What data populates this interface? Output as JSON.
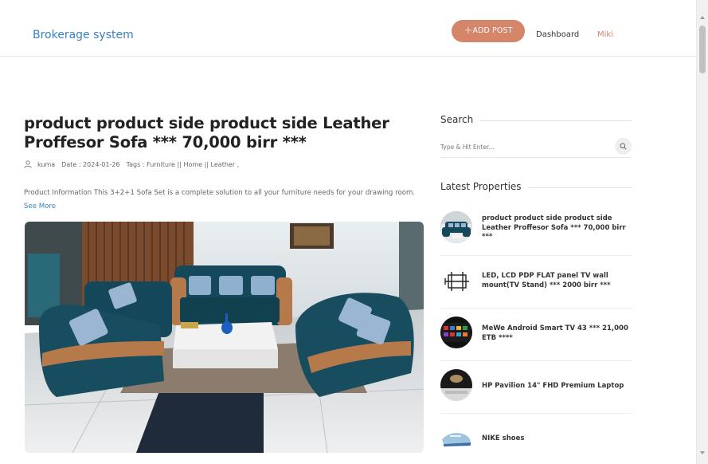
{
  "header": {
    "brand": "Brokerage system",
    "add_post_plus": "+",
    "add_post_label": "ADD POST",
    "nav_dashboard": "Dashboard",
    "nav_user": "Miki"
  },
  "post": {
    "title": "product product side product side Leather Proffesor Sofa *** 70,000 birr ***",
    "author": "kuma",
    "date": "Date : 2024-01-26",
    "tags": "Tags :  Furniture || Home || Leather ,",
    "excerpt": "Product Information This 3+2+1 Sofa Set is a complete solution to all your furniture needs for your drawing room.",
    "see_more": "See More"
  },
  "sidebar": {
    "search_heading": "Search",
    "search_placeholder": "Type & Hit Enter...",
    "latest_heading": "Latest Properties",
    "properties": [
      {
        "title": "product product side product side Leather Proffesor Sofa *** 70,000 birr ***",
        "thumb": "sofa-thumb"
      },
      {
        "title": "LED, LCD PDP FLAT panel TV wall mount(TV Stand) *** 2000 birr ***",
        "thumb": "tv-mount-thumb"
      },
      {
        "title": "MeWe Android Smart TV 43 *** 21,000 ETB ****",
        "thumb": "smart-tv-thumb"
      },
      {
        "title": "HP Pavilion 14\" FHD Premium Laptop",
        "thumb": "laptop-thumb"
      },
      {
        "title": "NIKE shoes",
        "thumb": "shoes-thumb"
      }
    ]
  },
  "colors": {
    "brand_blue": "#3a7fc4",
    "accent": "#d4856a",
    "sofa_teal": "#15485a"
  }
}
